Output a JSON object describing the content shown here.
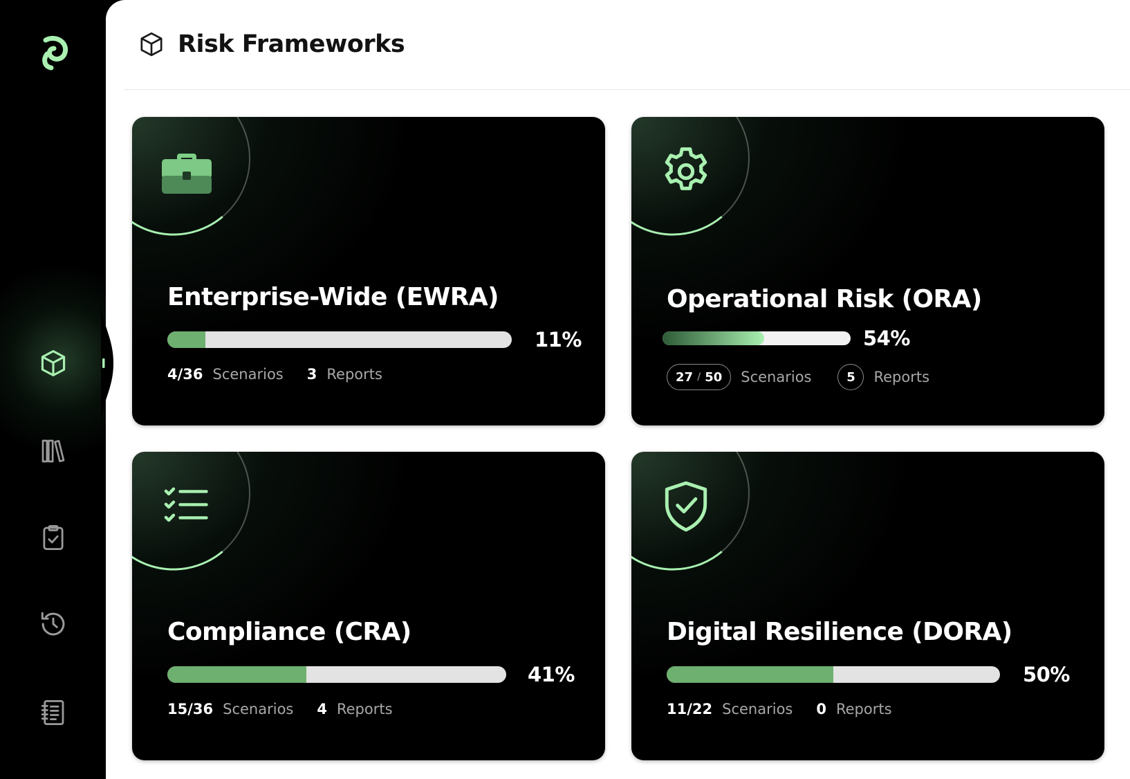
{
  "header": {
    "title": "Risk Frameworks",
    "icon": "cube-icon"
  },
  "sidebar": {
    "logo": "brand-logo",
    "items": [
      {
        "name": "frameworks",
        "icon": "cube-icon",
        "active": true
      },
      {
        "name": "library",
        "icon": "books-icon",
        "active": false
      },
      {
        "name": "tasks",
        "icon": "clipboard-check-icon",
        "active": false
      },
      {
        "name": "history",
        "icon": "history-icon",
        "active": false
      },
      {
        "name": "reports",
        "icon": "notebook-icon",
        "active": false
      }
    ]
  },
  "colors": {
    "accent": "#a9f0b1",
    "bar": "#6db06f",
    "track": "#e3e3e3"
  },
  "cards": [
    {
      "title": "Enterprise-Wide (EWRA)",
      "icon": "briefcase-icon",
      "progress": 11,
      "percent_label": "11%",
      "scenarios": "4/36",
      "scenarios_label": "Scenarios",
      "reports": "3",
      "reports_label": "Reports"
    },
    {
      "title": "Operational Risk (ORA)",
      "icon": "gear-icon",
      "progress": 54,
      "percent_label": "54%",
      "scenarios_done": "27",
      "scenarios_total": "50",
      "scenarios_sep": "/",
      "scenarios_label": "Scenarios",
      "reports": "5",
      "reports_label": "Reports"
    },
    {
      "title": "Compliance (CRA)",
      "icon": "checklist-icon",
      "progress": 41,
      "percent_label": "41%",
      "scenarios": "15/36",
      "scenarios_label": "Scenarios",
      "reports": "4",
      "reports_label": "Reports"
    },
    {
      "title": "Digital Resilience (DORA)",
      "icon": "shield-check-icon",
      "progress": 50,
      "percent_label": "50%",
      "scenarios": "11/22",
      "scenarios_label": "Scenarios",
      "reports": "0",
      "reports_label": "Reports"
    }
  ]
}
